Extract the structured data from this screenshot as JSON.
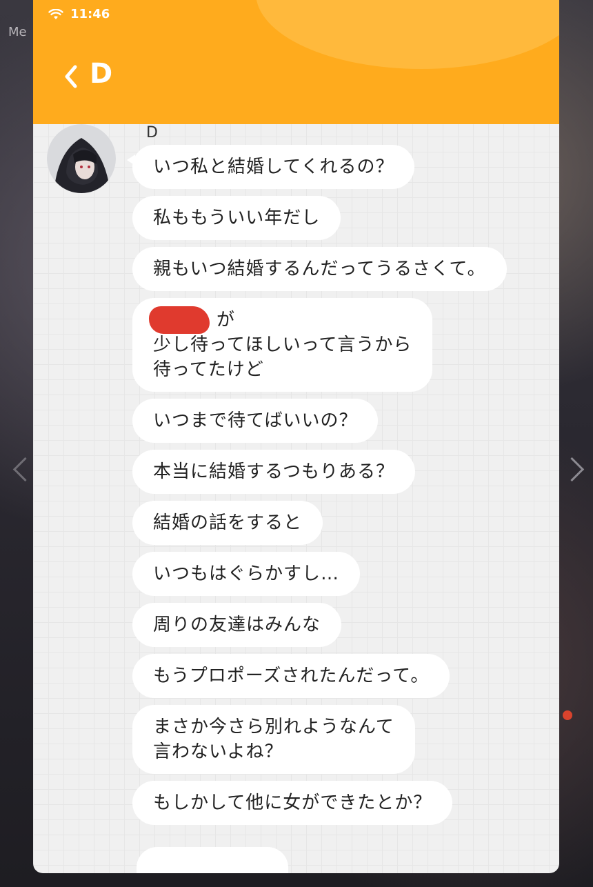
{
  "background": {
    "partial_label": "Me"
  },
  "status_bar": {
    "time": "11:46"
  },
  "header": {
    "title": "D",
    "accent_color": "#ffab1d"
  },
  "chat": {
    "sender_name": "D",
    "messages": [
      {
        "text": "いつ私と結婚してくれるの？"
      },
      {
        "text": "私ももういい年だし"
      },
      {
        "text": "親もいつ結婚するんだってうるさくて。"
      },
      {
        "text": "が\n少し待ってほしいって言うから\n待ってたけど",
        "redacted": true
      },
      {
        "text": "いつまで待てばいいの？"
      },
      {
        "text": "本当に結婚するつもりある？"
      },
      {
        "text": "結婚の話をすると"
      },
      {
        "text": "いつもはぐらかすし…"
      },
      {
        "text": "周りの友達はみんな"
      },
      {
        "text": "もうプロポーズされたんだって。"
      },
      {
        "text": "まさか今さら別れようなんて\n言わないよね？"
      },
      {
        "text": "もしかして他に女ができたとか？"
      }
    ]
  }
}
